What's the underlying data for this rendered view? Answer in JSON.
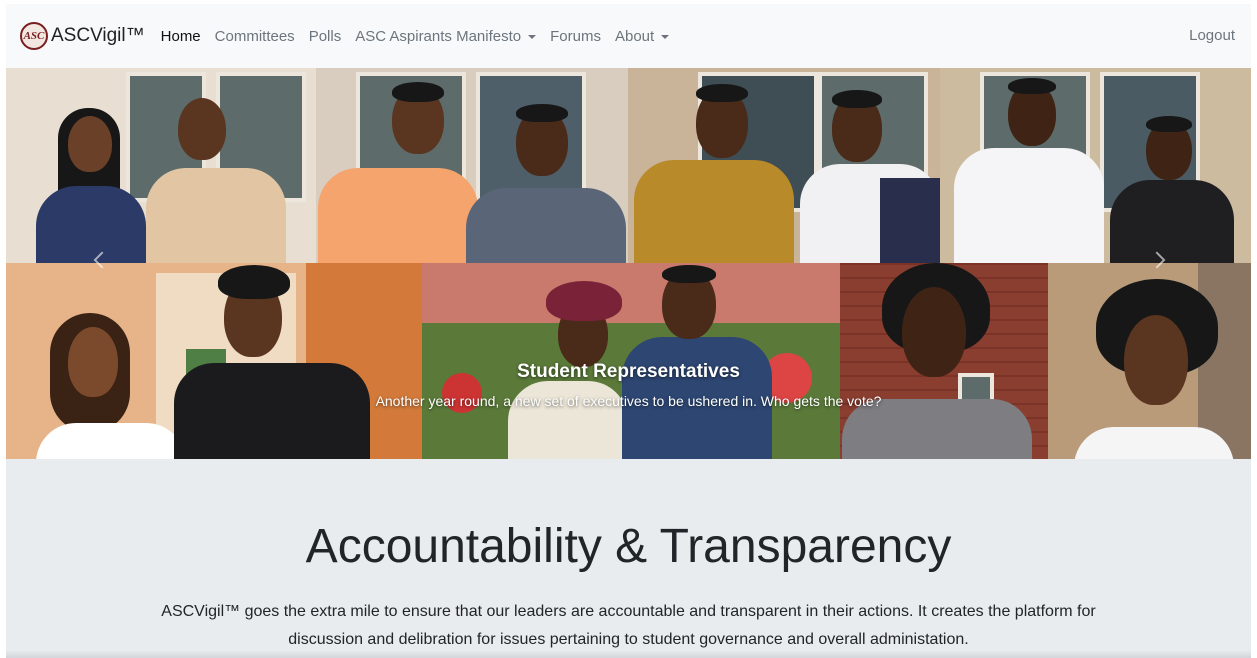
{
  "navbar": {
    "brand": "ASCVigil™",
    "logo_text": "ASC",
    "items": [
      {
        "label": "Home",
        "active": true,
        "dropdown": false
      },
      {
        "label": "Committees",
        "active": false,
        "dropdown": false
      },
      {
        "label": "Polls",
        "active": false,
        "dropdown": false
      },
      {
        "label": "ASC Aspirants Manifesto",
        "active": false,
        "dropdown": true
      },
      {
        "label": "Forums",
        "active": false,
        "dropdown": false
      },
      {
        "label": "About",
        "active": false,
        "dropdown": true
      }
    ],
    "logout": "Logout"
  },
  "carousel": {
    "caption_title": "Student Representatives",
    "caption_text": "Another year round, a new set of executives to be ushered in. Who gets the vote?"
  },
  "jumbotron": {
    "heading": "Accountability & Transparency",
    "lead": "ASCVigil™ goes the extra mile to ensure that our leaders are accountable and transparent in their actions. It creates the platform for discussion and delibration for issues pertaining to student governance and overall administation."
  },
  "colors": {
    "navbar_bg": "#f8f9fa",
    "nav_text": "#6c757d",
    "jumbotron_bg": "#e9ecef",
    "brand_logo": "#7a1f1f"
  }
}
